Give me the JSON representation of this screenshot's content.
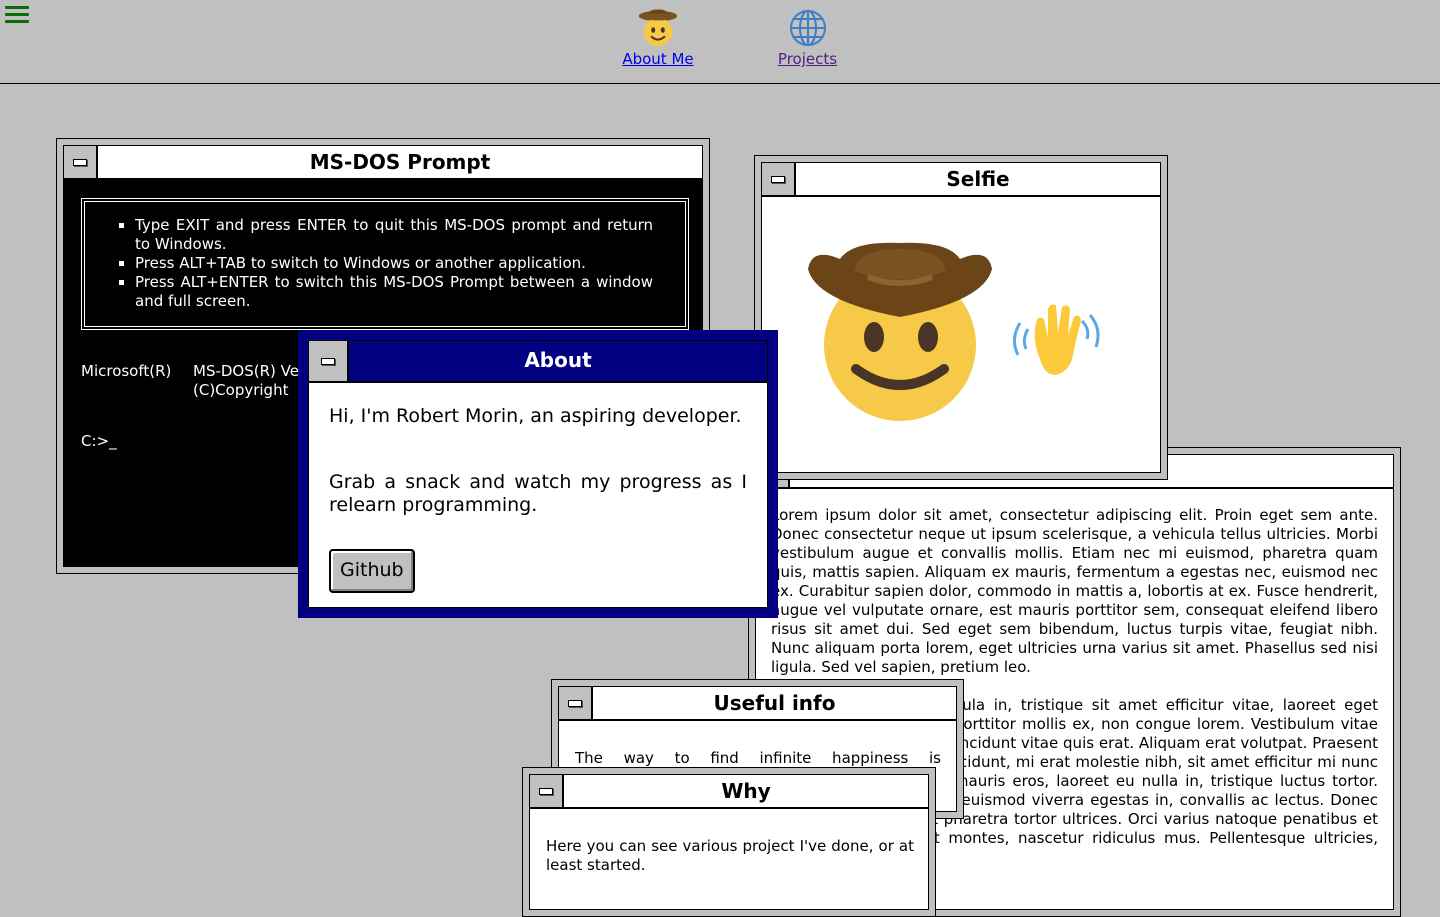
{
  "nav": {
    "menu_icon": "hamburger-icon",
    "items": [
      {
        "label": "About Me",
        "icon": "cowboy-emoji"
      },
      {
        "label": "Projects",
        "icon": "globe-icon"
      }
    ]
  },
  "dos_window": {
    "title": "MS-DOS Prompt",
    "help_items": [
      "Type EXIT and press ENTER to quit this MS-DOS prompt and return to Windows.",
      "Press ALT+TAB to switch to Windows or another application.",
      "Press ALT+ENTER to switch this MS-DOS Prompt between a window and full screen."
    ],
    "version_left": "Microsoft(R)",
    "version_line1": "MS-DOS(R) Ve",
    "version_line2": "(C)Copyright",
    "prompt": "C:>_"
  },
  "selfie_window": {
    "title": "Selfie",
    "images": [
      "cowboy-emoji",
      "waving-hand-emoji"
    ]
  },
  "lorem_window": {
    "para1": "Lorem ipsum dolor sit amet, consectetur adipiscing elit. Proin eget sem ante. Donec consectetur neque ut ipsum scelerisque, a vehicula tellus ultricies. Morbi vestibulum augue et convallis mollis. Etiam nec mi euismod, pharetra quam quis, mattis sapien. Aliquam ex mauris, fermentum a egestas nec, euismod nec ex. Curabitur sapien dolor, commodo in mattis a, lobortis at ex. Fusce hendrerit, augue vel vulputate ornare, est mauris porttitor sem, consequat eleifend libero risus sit amet dui. Sed eget sem bibendum, luctus turpis vitae, feugiat nibh. Nunc aliquam porta lorem, eget ultricies urna varius sit amet. Phasellus sed nisi ligula. Sed vel sapien, pretium leo.",
    "para2": "Nulla facilisi. Nam id ligula in, tristique sit amet efficitur vitae, laoreet eget nunc. Nullam eu lectus porttitor mollis ex, non congue lorem. Vestibulum vitae nulla tincidunt, semper tincidunt vitae quis erat. Aliquam erat volutpat. Praesent a nunc et mi vehicula tincidunt, mi erat molestie nibh, sit amet efficitur mi nunc sed metus. Vestibulum mauris eros, laoreet eu nulla in, tristique luctus tortor. Pellentesque felis tellus, euismod viverra egestas in, convallis ac lectus. Donec molestie nibh nibh, ut pharetra tortor ultrices. Orci varius natoque penatibus et magnis dis parturient montes, nascetur ridiculus mus. Pellentesque ultricies, eros ac imperdiet"
  },
  "useful_window": {
    "title": "Useful info",
    "text": "The way to find infinite happiness is"
  },
  "why_window": {
    "title": "Why",
    "text": "Here you can see various project I've done, or at least started."
  },
  "about_window": {
    "title": "About",
    "line1": "Hi, I'm Robert Morin, an aspiring developer.",
    "line2": "Grab a snack and watch my progress as I relearn programming.",
    "button": "Github"
  },
  "colors": {
    "desktop": "#c0c0c0",
    "active_title": "#000080",
    "menu_icon": "#0b6b0b",
    "link": "#0000ee",
    "visited_link": "#551a8b"
  }
}
